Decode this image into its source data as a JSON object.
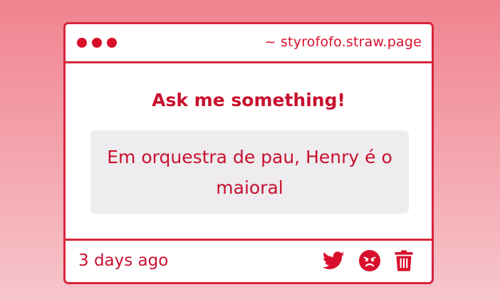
{
  "window": {
    "url": "~ styrofofo.straw.page"
  },
  "main": {
    "heading": "Ask me something!",
    "question": "Em orquestra de pau, Henry é o maioral"
  },
  "footer": {
    "timestamp": "3 days ago",
    "actions": [
      {
        "icon": "twitter-icon"
      },
      {
        "icon": "angry-face-icon"
      },
      {
        "icon": "trash-icon"
      }
    ]
  },
  "colors": {
    "accent": "#d8102c",
    "text": "#c8102e",
    "box": "#eeecee",
    "background_top": "#f0838f",
    "background_bottom": "#f7c6cc"
  }
}
